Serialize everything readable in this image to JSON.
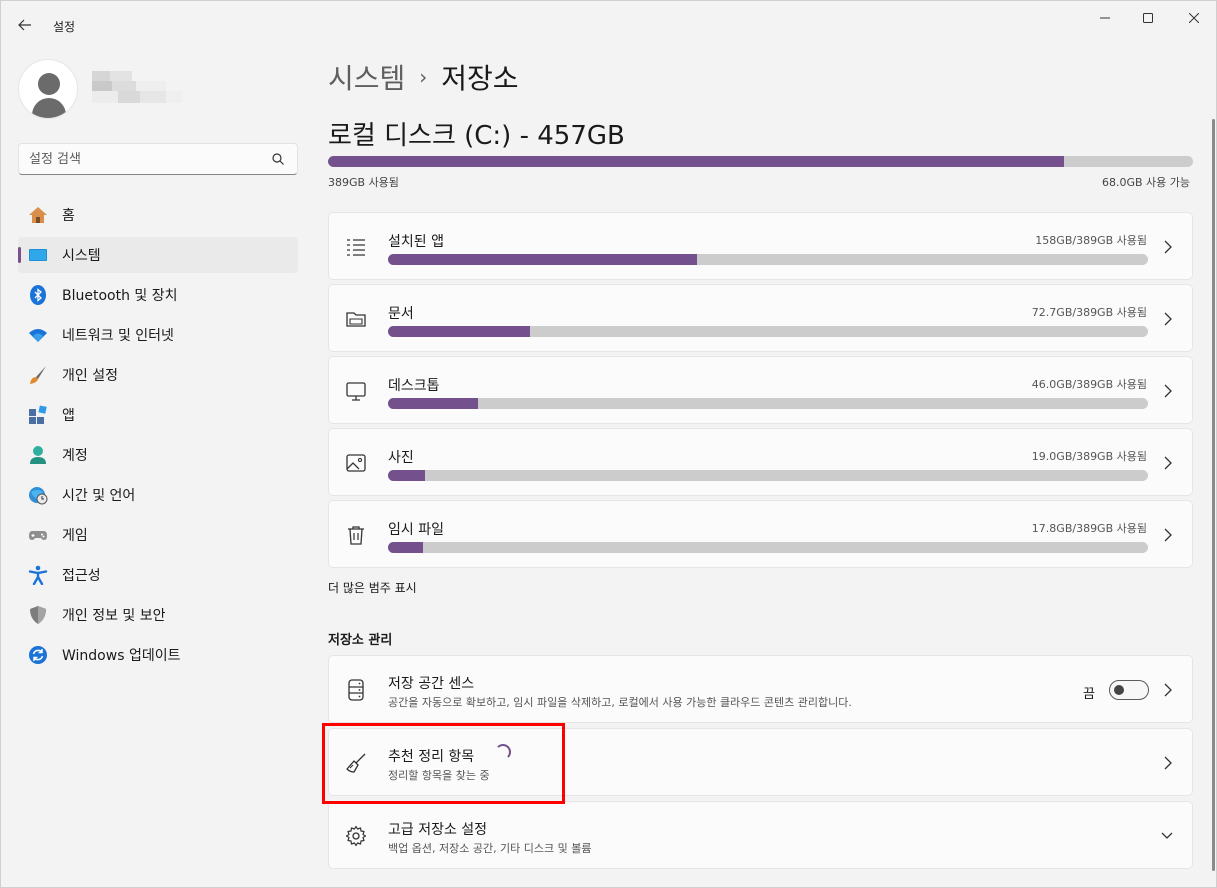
{
  "window": {
    "back_icon": "back-arrow-icon",
    "app_title": "설정"
  },
  "sidebar": {
    "search_placeholder": "설정 검색",
    "items": [
      {
        "label": "홈",
        "icon": "home-icon",
        "active": false
      },
      {
        "label": "시스템",
        "icon": "system-icon",
        "active": true
      },
      {
        "label": "Bluetooth 및 장치",
        "icon": "bluetooth-icon",
        "active": false
      },
      {
        "label": "네트워크 및 인터넷",
        "icon": "wifi-icon",
        "active": false
      },
      {
        "label": "개인 설정",
        "icon": "brush-icon",
        "active": false
      },
      {
        "label": "앱",
        "icon": "apps-icon",
        "active": false
      },
      {
        "label": "계정",
        "icon": "account-icon",
        "active": false
      },
      {
        "label": "시간 및 언어",
        "icon": "time-language-icon",
        "active": false
      },
      {
        "label": "게임",
        "icon": "gamepad-icon",
        "active": false
      },
      {
        "label": "접근성",
        "icon": "accessibility-icon",
        "active": false
      },
      {
        "label": "개인 정보 및 보안",
        "icon": "shield-icon",
        "active": false
      },
      {
        "label": "Windows 업데이트",
        "icon": "update-icon",
        "active": false
      }
    ]
  },
  "breadcrumb": {
    "parent": "시스템",
    "separator": "›",
    "current": "저장소"
  },
  "disk": {
    "title": "로컬 디스크 (C:) - 457GB",
    "used_label": "389GB 사용됨",
    "free_label": "68.0GB 사용 가능",
    "used_fraction": 0.851
  },
  "categories": [
    {
      "name": "설치된 앱",
      "size": "158GB/389GB 사용됨",
      "fraction": 0.406,
      "icon": "list-icon"
    },
    {
      "name": "문서",
      "size": "72.7GB/389GB 사용됨",
      "fraction": 0.187,
      "icon": "folder-icon"
    },
    {
      "name": "데스크톱",
      "size": "46.0GB/389GB 사용됨",
      "fraction": 0.118,
      "icon": "monitor-icon"
    },
    {
      "name": "사진",
      "size": "19.0GB/389GB 사용됨",
      "fraction": 0.049,
      "icon": "picture-icon"
    },
    {
      "name": "임시 파일",
      "size": "17.8GB/389GB 사용됨",
      "fraction": 0.046,
      "icon": "trash-icon"
    }
  ],
  "more_link": "더 많은 범주 표시",
  "management": {
    "section_title": "저장소 관리",
    "storage_sense": {
      "title": "저장 공간 센스",
      "desc": "공간을 자동으로 확보하고, 임시 파일을 삭제하고, 로컬에서 사용 가능한 클라우드 콘텐츠 관리합니다.",
      "toggle_label": "끔",
      "enabled": false
    },
    "cleanup": {
      "title": "추천 정리 항목",
      "desc": "정리할 항목을 찾는 중"
    },
    "advanced": {
      "title": "고급 저장소 설정",
      "desc": "백업 옵션, 저장소 공간, 기타 디스크 및 볼륨"
    }
  },
  "colors": {
    "accent": "#74508c",
    "bar_track": "#cccccc",
    "highlight": "#ff0000"
  }
}
